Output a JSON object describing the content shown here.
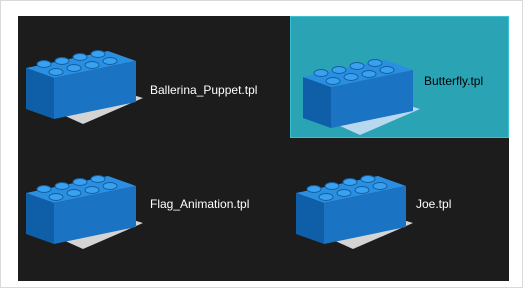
{
  "templates": [
    {
      "name": "Ballerina_Puppet.tpl",
      "selected": false
    },
    {
      "name": "Butterfly.tpl",
      "selected": true
    },
    {
      "name": "Flag_Animation.tpl",
      "selected": false
    },
    {
      "name": "Joe.tpl",
      "selected": false
    }
  ],
  "colors": {
    "panel_bg": "#1c1c1c",
    "selection_bg": "#2aa3b5",
    "brick_top": "#2a8fe0",
    "brick_front": "#1b73c4",
    "brick_side": "#0f5ea8",
    "base": "#d4d4d4"
  },
  "icons": {
    "template": "lego-brick-icon"
  }
}
